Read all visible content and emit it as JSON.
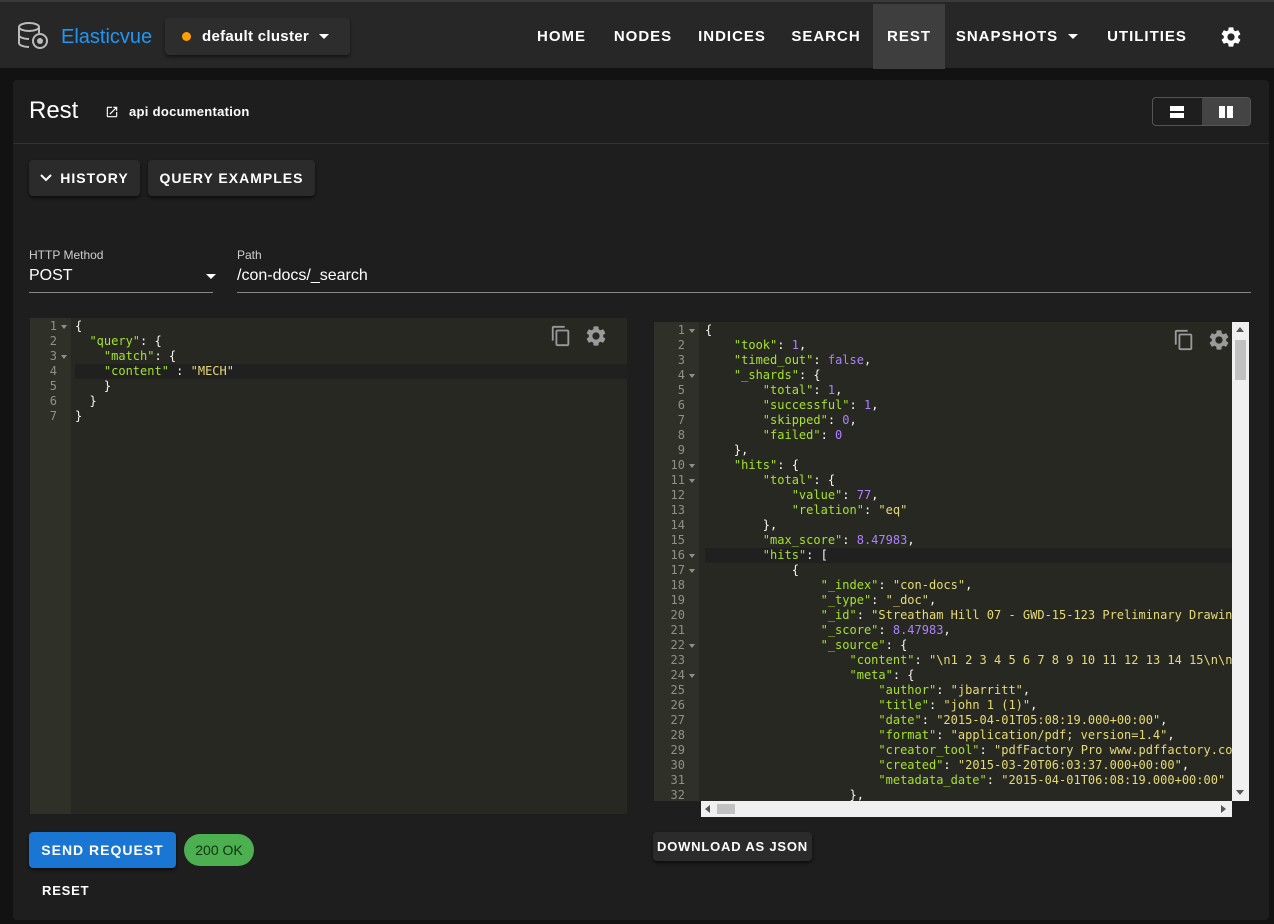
{
  "brand": "Elasticvue",
  "cluster": {
    "name": "default cluster",
    "status_color": "#ffa000"
  },
  "nav": [
    "HOME",
    "NODES",
    "INDICES",
    "SEARCH",
    "REST",
    "SNAPSHOTS",
    "UTILITIES"
  ],
  "nav_active": "REST",
  "page": {
    "title": "Rest",
    "api_doc": "api documentation"
  },
  "buttons": {
    "history": "HISTORY",
    "query_examples": "QUERY EXAMPLES",
    "send": "SEND REQUEST",
    "reset": "RESET",
    "download": "DOWNLOAD AS JSON"
  },
  "form": {
    "method_label": "HTTP Method",
    "method": "POST",
    "path_label": "Path",
    "path": "/con-docs/_search"
  },
  "status": "200 OK",
  "colors": {
    "accent": "#1976d2",
    "brand": "#2196f3",
    "status_ok": "#4caf50"
  },
  "request_lines": [
    [
      [
        "p",
        "{"
      ]
    ],
    [
      [
        "p",
        "  "
      ],
      [
        "k",
        "\"query\""
      ],
      [
        "p",
        ": {"
      ]
    ],
    [
      [
        "p",
        "    "
      ],
      [
        "k",
        "\"match\""
      ],
      [
        "p",
        ": {"
      ]
    ],
    [
      [
        "p",
        "    "
      ],
      [
        "k",
        "\"content\""
      ],
      [
        "p",
        " : "
      ],
      [
        "s",
        "\"MECH\""
      ]
    ],
    [
      [
        "p",
        "    }"
      ]
    ],
    [
      [
        "p",
        "  }"
      ]
    ],
    [
      [
        "p",
        "}"
      ]
    ]
  ],
  "request_folds": [
    1,
    3
  ],
  "response_lines": [
    [
      [
        "p",
        "{"
      ]
    ],
    [
      [
        "p",
        "    "
      ],
      [
        "k",
        "\"took\""
      ],
      [
        "p",
        ": "
      ],
      [
        "n",
        "1"
      ],
      [
        "p",
        ","
      ]
    ],
    [
      [
        "p",
        "    "
      ],
      [
        "k",
        "\"timed_out\""
      ],
      [
        "p",
        ": "
      ],
      [
        "n",
        "false"
      ],
      [
        "p",
        ","
      ]
    ],
    [
      [
        "p",
        "    "
      ],
      [
        "k",
        "\"_shards\""
      ],
      [
        "p",
        ": {"
      ]
    ],
    [
      [
        "p",
        "        "
      ],
      [
        "k",
        "\"total\""
      ],
      [
        "p",
        ": "
      ],
      [
        "n",
        "1"
      ],
      [
        "p",
        ","
      ]
    ],
    [
      [
        "p",
        "        "
      ],
      [
        "k",
        "\"successful\""
      ],
      [
        "p",
        ": "
      ],
      [
        "n",
        "1"
      ],
      [
        "p",
        ","
      ]
    ],
    [
      [
        "p",
        "        "
      ],
      [
        "k",
        "\"skipped\""
      ],
      [
        "p",
        ": "
      ],
      [
        "n",
        "0"
      ],
      [
        "p",
        ","
      ]
    ],
    [
      [
        "p",
        "        "
      ],
      [
        "k",
        "\"failed\""
      ],
      [
        "p",
        ": "
      ],
      [
        "n",
        "0"
      ]
    ],
    [
      [
        "p",
        "    },"
      ]
    ],
    [
      [
        "p",
        "    "
      ],
      [
        "k",
        "\"hits\""
      ],
      [
        "p",
        ": {"
      ]
    ],
    [
      [
        "p",
        "        "
      ],
      [
        "k",
        "\"total\""
      ],
      [
        "p",
        ": {"
      ]
    ],
    [
      [
        "p",
        "            "
      ],
      [
        "k",
        "\"value\""
      ],
      [
        "p",
        ": "
      ],
      [
        "n",
        "77"
      ],
      [
        "p",
        ","
      ]
    ],
    [
      [
        "p",
        "            "
      ],
      [
        "k",
        "\"relation\""
      ],
      [
        "p",
        ": "
      ],
      [
        "s",
        "\"eq\""
      ]
    ],
    [
      [
        "p",
        "        },"
      ]
    ],
    [
      [
        "p",
        "        "
      ],
      [
        "k",
        "\"max_score\""
      ],
      [
        "p",
        ": "
      ],
      [
        "n",
        "8.47983"
      ],
      [
        "p",
        ","
      ]
    ],
    [
      [
        "p",
        "        "
      ],
      [
        "k",
        "\"hits\""
      ],
      [
        "p",
        ": ["
      ]
    ],
    [
      [
        "p",
        "            {"
      ]
    ],
    [
      [
        "p",
        "                "
      ],
      [
        "k",
        "\"_index\""
      ],
      [
        "p",
        ": "
      ],
      [
        "s",
        "\"con-docs\""
      ],
      [
        "p",
        ","
      ]
    ],
    [
      [
        "p",
        "                "
      ],
      [
        "k",
        "\"_type\""
      ],
      [
        "p",
        ": "
      ],
      [
        "s",
        "\"_doc\""
      ],
      [
        "p",
        ","
      ]
    ],
    [
      [
        "p",
        "                "
      ],
      [
        "k",
        "\"_id\""
      ],
      [
        "p",
        ": "
      ],
      [
        "s",
        "\"Streatham Hill 07 - GWD-15-123 Preliminary Drawin"
      ]
    ],
    [
      [
        "p",
        "                "
      ],
      [
        "k",
        "\"_score\""
      ],
      [
        "p",
        ": "
      ],
      [
        "n",
        "8.47983"
      ],
      [
        "p",
        ","
      ]
    ],
    [
      [
        "p",
        "                "
      ],
      [
        "k",
        "\"_source\""
      ],
      [
        "p",
        ": {"
      ]
    ],
    [
      [
        "p",
        "                    "
      ],
      [
        "k",
        "\"content\""
      ],
      [
        "p",
        ": "
      ],
      [
        "s",
        "\"\\n1 2 3 4 5 6 7 8 9 10 11 12 13 14 15\\n\\n"
      ]
    ],
    [
      [
        "p",
        "                    "
      ],
      [
        "k",
        "\"meta\""
      ],
      [
        "p",
        ": {"
      ]
    ],
    [
      [
        "p",
        "                        "
      ],
      [
        "k",
        "\"author\""
      ],
      [
        "p",
        ": "
      ],
      [
        "s",
        "\"jbarritt\""
      ],
      [
        "p",
        ","
      ]
    ],
    [
      [
        "p",
        "                        "
      ],
      [
        "k",
        "\"title\""
      ],
      [
        "p",
        ": "
      ],
      [
        "s",
        "\"john 1 (1)\""
      ],
      [
        "p",
        ","
      ]
    ],
    [
      [
        "p",
        "                        "
      ],
      [
        "k",
        "\"date\""
      ],
      [
        "p",
        ": "
      ],
      [
        "s",
        "\"2015-04-01T05:08:19.000+00:00\""
      ],
      [
        "p",
        ","
      ]
    ],
    [
      [
        "p",
        "                        "
      ],
      [
        "k",
        "\"format\""
      ],
      [
        "p",
        ": "
      ],
      [
        "s",
        "\"application/pdf; version=1.4\""
      ],
      [
        "p",
        ","
      ]
    ],
    [
      [
        "p",
        "                        "
      ],
      [
        "k",
        "\"creator_tool\""
      ],
      [
        "p",
        ": "
      ],
      [
        "s",
        "\"pdfFactory Pro www.pdffactory.co"
      ]
    ],
    [
      [
        "p",
        "                        "
      ],
      [
        "k",
        "\"created\""
      ],
      [
        "p",
        ": "
      ],
      [
        "s",
        "\"2015-03-20T06:03:37.000+00:00\""
      ],
      [
        "p",
        ","
      ]
    ],
    [
      [
        "p",
        "                        "
      ],
      [
        "k",
        "\"metadata_date\""
      ],
      [
        "p",
        ": "
      ],
      [
        "s",
        "\"2015-04-01T06:08:19.000+00:00\""
      ]
    ],
    [
      [
        "p",
        "                    },"
      ]
    ],
    [
      [
        "p",
        ""
      ]
    ]
  ],
  "response_folds": [
    1,
    4,
    10,
    11,
    16,
    17,
    22,
    24
  ]
}
